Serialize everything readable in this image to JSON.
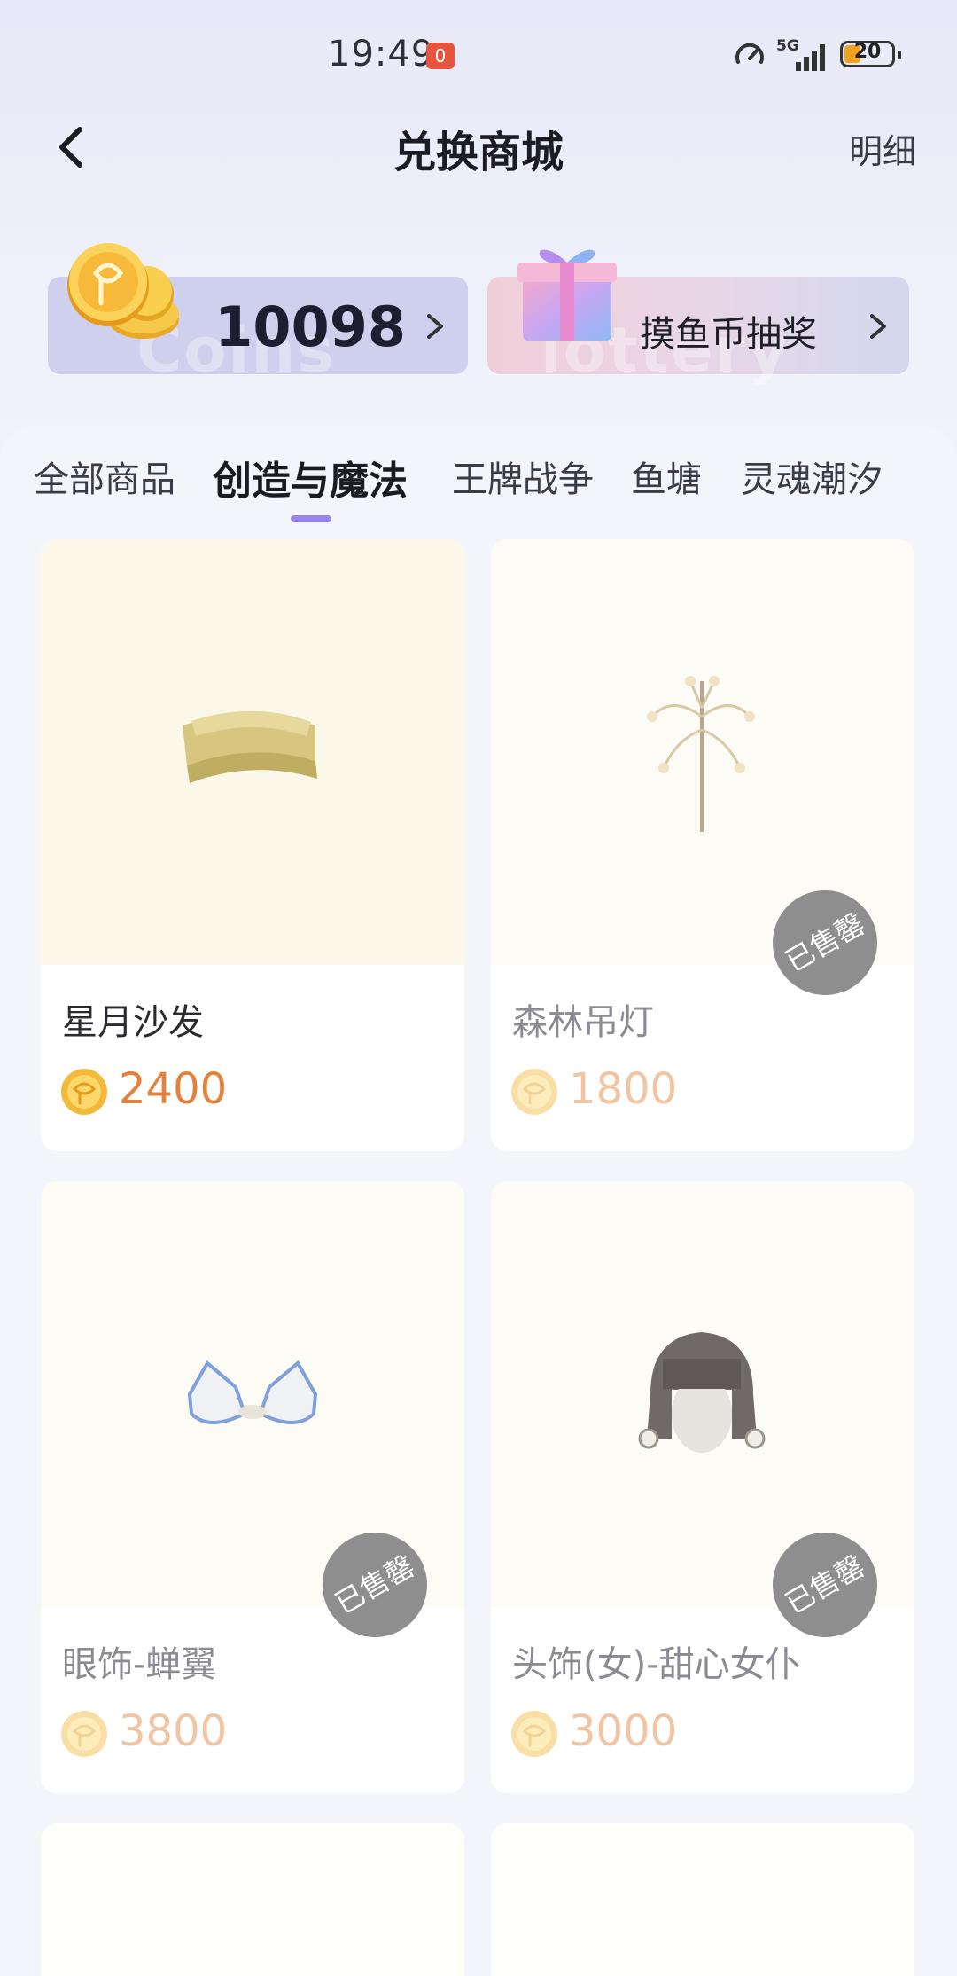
{
  "status_bar": {
    "time": "19:49",
    "notification_count": "0",
    "network": "5G",
    "battery": "20"
  },
  "header": {
    "title": "兑换商城",
    "detail_label": "明细"
  },
  "coins": {
    "balance": "10098",
    "watermark": "Coins"
  },
  "lottery": {
    "label": "摸鱼币抽奖",
    "watermark": "lottery"
  },
  "tabs": [
    {
      "label": "全部商品"
    },
    {
      "label": "创造与魔法"
    },
    {
      "label": "王牌战争"
    },
    {
      "label": "鱼塘"
    },
    {
      "label": "灵魂潮汐"
    }
  ],
  "active_tab": "创造与魔法",
  "sold_out_label": "已售罄",
  "products": [
    {
      "name": "星月沙发",
      "price": "2400",
      "sold_out": false
    },
    {
      "name": "森林吊灯",
      "price": "1800",
      "sold_out": true
    },
    {
      "name": "眼饰-蝉翼",
      "price": "3800",
      "sold_out": true
    },
    {
      "name": "头饰(女)-甜心女仆",
      "price": "3000",
      "sold_out": true
    }
  ],
  "colors": {
    "accent": "#9a84f2",
    "price": "#e4823d",
    "price_sold": "#f1c4a2",
    "sold_badge": "#8e8e8e"
  }
}
